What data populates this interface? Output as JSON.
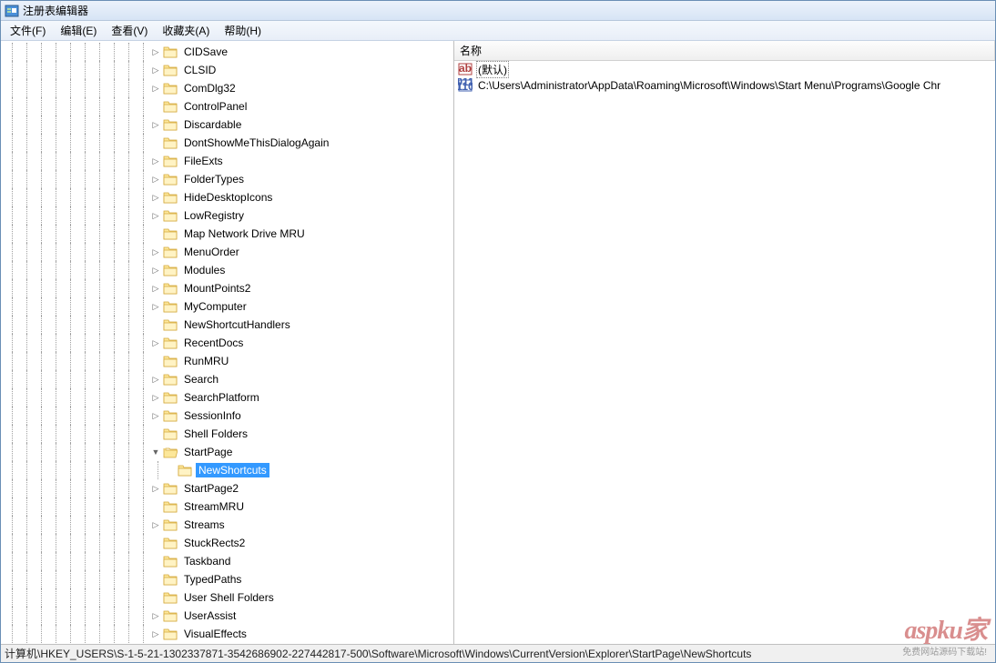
{
  "window": {
    "title": "注册表编辑器"
  },
  "menubar": {
    "items": [
      "文件(F)",
      "编辑(E)",
      "查看(V)",
      "收藏夹(A)",
      "帮助(H)"
    ]
  },
  "tree": {
    "items": [
      {
        "depth": 10,
        "label": "CIDSave",
        "expander": "closed"
      },
      {
        "depth": 10,
        "label": "CLSID",
        "expander": "closed"
      },
      {
        "depth": 10,
        "label": "ComDlg32",
        "expander": "closed"
      },
      {
        "depth": 10,
        "label": "ControlPanel",
        "expander": "none"
      },
      {
        "depth": 10,
        "label": "Discardable",
        "expander": "closed"
      },
      {
        "depth": 10,
        "label": "DontShowMeThisDialogAgain",
        "expander": "none"
      },
      {
        "depth": 10,
        "label": "FileExts",
        "expander": "closed"
      },
      {
        "depth": 10,
        "label": "FolderTypes",
        "expander": "closed"
      },
      {
        "depth": 10,
        "label": "HideDesktopIcons",
        "expander": "closed"
      },
      {
        "depth": 10,
        "label": "LowRegistry",
        "expander": "closed"
      },
      {
        "depth": 10,
        "label": "Map Network Drive MRU",
        "expander": "none"
      },
      {
        "depth": 10,
        "label": "MenuOrder",
        "expander": "closed"
      },
      {
        "depth": 10,
        "label": "Modules",
        "expander": "closed"
      },
      {
        "depth": 10,
        "label": "MountPoints2",
        "expander": "closed"
      },
      {
        "depth": 10,
        "label": "MyComputer",
        "expander": "closed"
      },
      {
        "depth": 10,
        "label": "NewShortcutHandlers",
        "expander": "none"
      },
      {
        "depth": 10,
        "label": "RecentDocs",
        "expander": "closed"
      },
      {
        "depth": 10,
        "label": "RunMRU",
        "expander": "none"
      },
      {
        "depth": 10,
        "label": "Search",
        "expander": "closed"
      },
      {
        "depth": 10,
        "label": "SearchPlatform",
        "expander": "closed"
      },
      {
        "depth": 10,
        "label": "SessionInfo",
        "expander": "closed"
      },
      {
        "depth": 10,
        "label": "Shell Folders",
        "expander": "none"
      },
      {
        "depth": 10,
        "label": "StartPage",
        "expander": "open"
      },
      {
        "depth": 11,
        "label": "NewShortcuts",
        "expander": "none",
        "selected": true
      },
      {
        "depth": 10,
        "label": "StartPage2",
        "expander": "closed"
      },
      {
        "depth": 10,
        "label": "StreamMRU",
        "expander": "none"
      },
      {
        "depth": 10,
        "label": "Streams",
        "expander": "closed"
      },
      {
        "depth": 10,
        "label": "StuckRects2",
        "expander": "none"
      },
      {
        "depth": 10,
        "label": "Taskband",
        "expander": "none"
      },
      {
        "depth": 10,
        "label": "TypedPaths",
        "expander": "none"
      },
      {
        "depth": 10,
        "label": "User Shell Folders",
        "expander": "none"
      },
      {
        "depth": 10,
        "label": "UserAssist",
        "expander": "closed"
      },
      {
        "depth": 10,
        "label": "VisualEffects",
        "expander": "closed"
      }
    ]
  },
  "list": {
    "header": {
      "name": "名称"
    },
    "items": [
      {
        "type": "string",
        "name": "(默认)",
        "focused": true
      },
      {
        "type": "binary",
        "name": "C:\\Users\\Administrator\\AppData\\Roaming\\Microsoft\\Windows\\Start Menu\\Programs\\Google Chr"
      }
    ]
  },
  "statusbar": {
    "path": "计算机\\HKEY_USERS\\S-1-5-21-1302337871-3542686902-227442817-500\\Software\\Microsoft\\Windows\\CurrentVersion\\Explorer\\StartPage\\NewShortcuts"
  },
  "watermark": {
    "main": "aspku家",
    "sub": "免费网站源码下载站!"
  }
}
